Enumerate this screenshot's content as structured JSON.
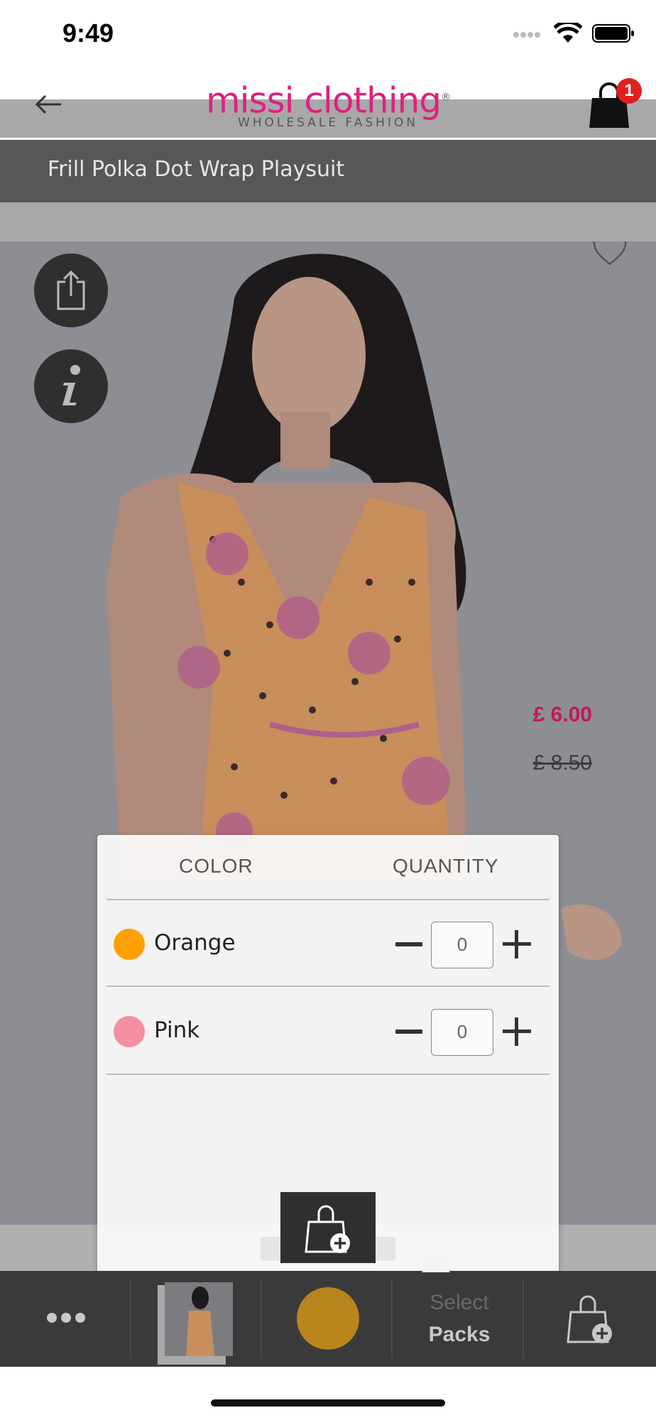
{
  "status_bar": {
    "time": "9:49",
    "icons": [
      "signal-icon",
      "wifi-icon",
      "battery-icon"
    ]
  },
  "header": {
    "logo_main": "missi clothing",
    "logo_registered": "®",
    "logo_sub": "WHOLESALE FASHION",
    "cart_count": "1",
    "brand_color": "#e0207f"
  },
  "product": {
    "title": "Frill Polka Dot Wrap Playsuit",
    "price_now": "£ 6.00",
    "price_was": "£ 8.50"
  },
  "popup": {
    "col_color": "COLOR",
    "col_quantity": "QUANTITY",
    "rows": [
      {
        "label": "Orange",
        "swatch": "#ffa000",
        "qty": "0"
      },
      {
        "label": "Pink",
        "swatch": "#f48fa1",
        "qty": "0"
      }
    ]
  },
  "bottom_bar": {
    "select_label": "Select",
    "packs_label": "Packs",
    "selected_color": "#b8861c"
  }
}
